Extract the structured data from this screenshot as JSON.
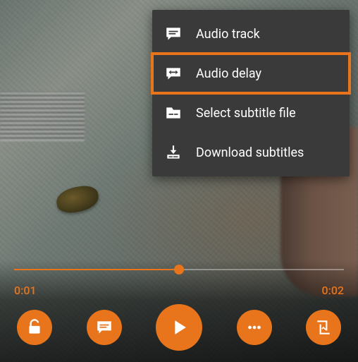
{
  "menu": {
    "items": [
      {
        "label": "Audio track",
        "icon": "speech-lines-icon",
        "highlighted": false
      },
      {
        "label": "Audio delay",
        "icon": "speech-arrows-icon",
        "highlighted": true
      },
      {
        "label": "Select subtitle file",
        "icon": "folder-icon",
        "highlighted": false
      },
      {
        "label": "Download subtitles",
        "icon": "download-icon",
        "highlighted": false
      }
    ]
  },
  "player": {
    "current_time": "0:01",
    "duration": "0:02",
    "progress_percent": 50
  },
  "colors": {
    "accent": "#e8741c",
    "menu_bg": "#3a3a3a"
  }
}
